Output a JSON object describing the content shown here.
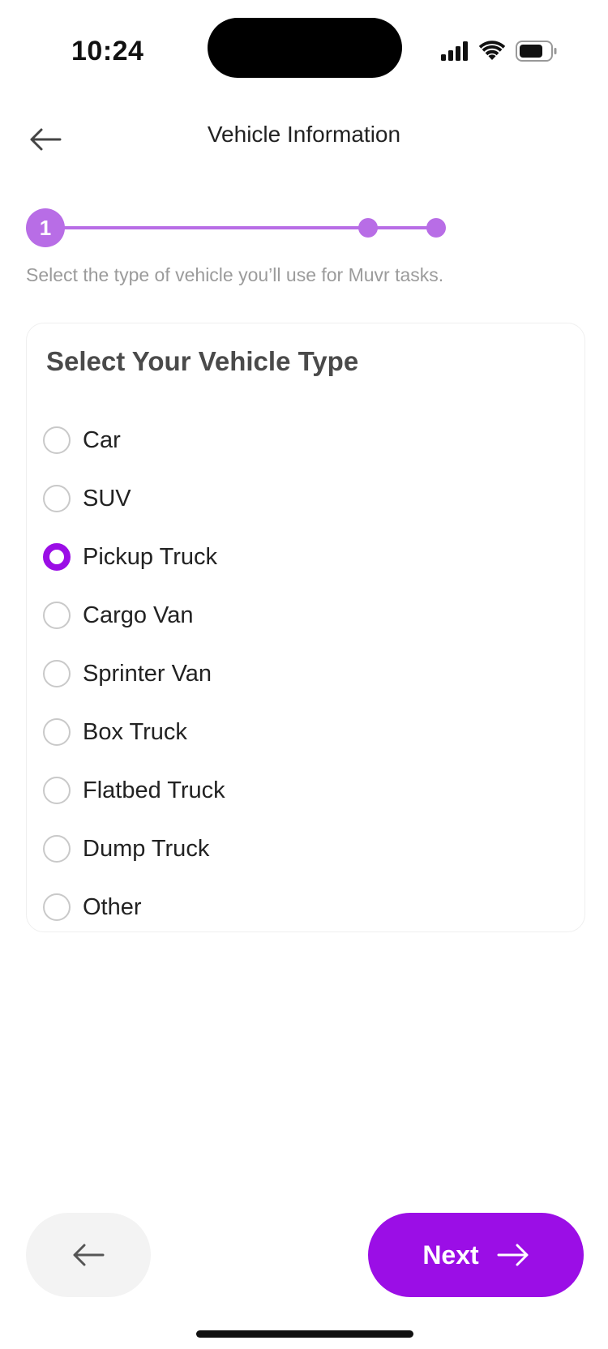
{
  "status_bar": {
    "time": "10:24",
    "icons": [
      "cellular-signal-icon",
      "wifi-icon",
      "battery-icon"
    ]
  },
  "nav": {
    "back_icon": "arrow-left-icon",
    "title": "Vehicle Information"
  },
  "stepper": {
    "current_step_label": "1",
    "total_steps": 3,
    "current_step": 1,
    "accent_color": "#b86de6"
  },
  "subtitle": "Select the type of vehicle you’ll use for Muvr tasks.",
  "vehicle_card": {
    "title": "Select Your Vehicle Type",
    "options": [
      {
        "label": "Car",
        "selected": false
      },
      {
        "label": "SUV",
        "selected": false
      },
      {
        "label": "Pickup Truck",
        "selected": true
      },
      {
        "label": "Cargo Van",
        "selected": false
      },
      {
        "label": "Sprinter Van",
        "selected": false
      },
      {
        "label": "Box Truck",
        "selected": false
      },
      {
        "label": "Flatbed Truck",
        "selected": false
      },
      {
        "label": "Dump Truck",
        "selected": false
      },
      {
        "label": "Other",
        "selected": false
      }
    ]
  },
  "footer": {
    "back_icon": "arrow-left-icon",
    "next_label": "Next",
    "next_icon": "arrow-right-icon",
    "primary_color": "#9b0ee6"
  }
}
